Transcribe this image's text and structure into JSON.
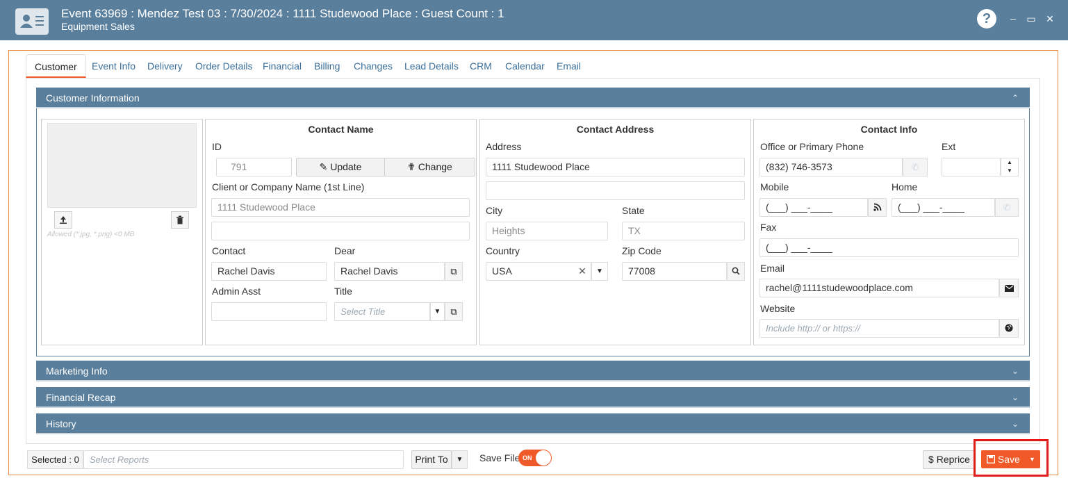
{
  "window": {
    "title": "Event 63969 : Mendez Test 03 : 7/30/2024 : 1111 Studewood Place : Guest Count : 1",
    "subtitle": "Equipment Sales",
    "help": "?",
    "minimize": "–",
    "maximize": "▭",
    "close": "✕"
  },
  "tabs": [
    "Customer",
    "Event Info",
    "Delivery",
    "Order Details",
    "Financial",
    "Billing",
    "Changes",
    "Lead Details",
    "CRM",
    "Calendar",
    "Email"
  ],
  "panels": {
    "customer_information": "Customer Information",
    "marketing_info": "Marketing Info",
    "financial_recap": "Financial Recap",
    "history": "History"
  },
  "photo": {
    "hint": "Allowed (*.jpg, *.png) <0 MB"
  },
  "contact_name": {
    "title": "Contact Name",
    "id_label": "ID",
    "id_value": "791",
    "update_label": "Update",
    "change_label": "Change",
    "company_label": "Client or Company Name (1st Line)",
    "company_value": "1111 Studewood Place",
    "company_line2": "",
    "contact_label": "Contact",
    "contact_value": "Rachel Davis",
    "dear_label": "Dear",
    "dear_value": "Rachel Davis",
    "admin_label": "Admin Asst",
    "admin_value": "",
    "title_label": "Title",
    "title_placeholder": "Select Title"
  },
  "contact_address": {
    "title": "Contact Address",
    "address_label": "Address",
    "address_value": "1111 Studewood Place",
    "address_line2": "",
    "city_label": "City",
    "city_value": "Heights",
    "state_label": "State",
    "state_value": "TX",
    "country_label": "Country",
    "country_value": "USA",
    "zip_label": "Zip Code",
    "zip_value": "77008"
  },
  "contact_info": {
    "title": "Contact Info",
    "office_label": "Office or Primary Phone",
    "office_value": "(832) 746-3573",
    "ext_label": "Ext",
    "ext_value": "",
    "mobile_label": "Mobile",
    "mobile_value": "(___) ___-____",
    "home_label": "Home",
    "home_value": "(___) ___-____",
    "fax_label": "Fax",
    "fax_value": "(___) ___-____",
    "email_label": "Email",
    "email_value": "rachel@1111studewoodplace.com",
    "website_label": "Website",
    "website_placeholder": "Include http:// or https://"
  },
  "footer": {
    "selected_label": "Selected : 0",
    "reports_placeholder": "Select Reports",
    "print_to": "Print To",
    "save_file_label": "Save File",
    "toggle_state": "ON",
    "reprice_label": "Reprice",
    "save_label": "Save"
  },
  "colors": {
    "header": "#5a7f9c",
    "accent": "#f05a28",
    "highlight": "#e21a1a"
  }
}
